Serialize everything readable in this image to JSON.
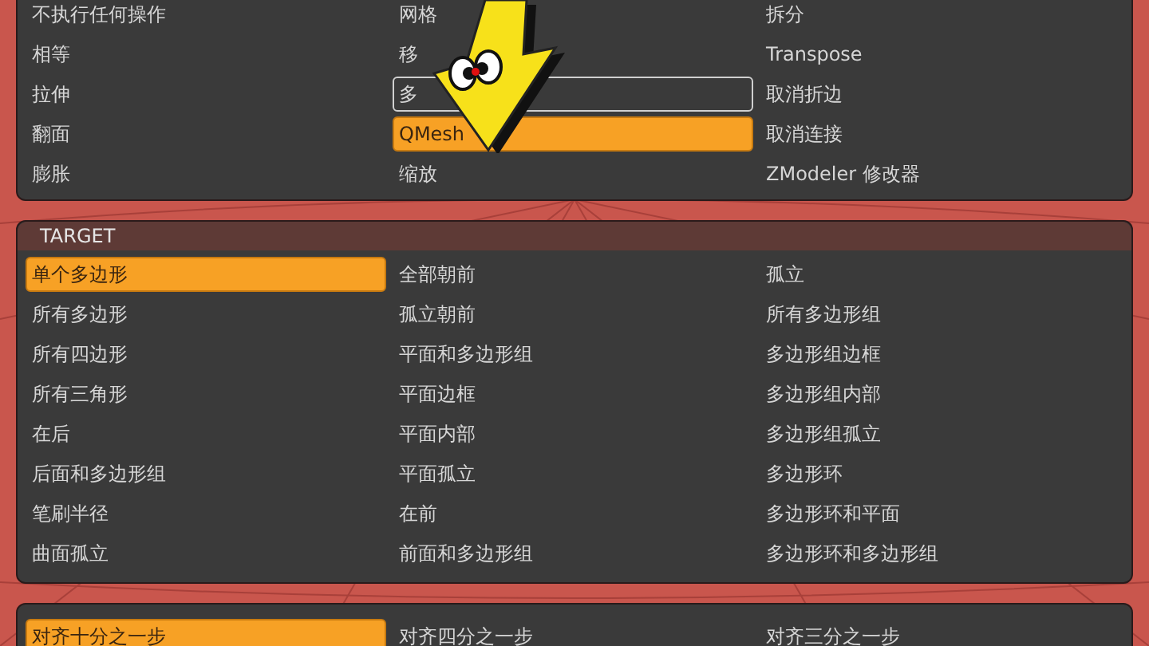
{
  "panels": [
    {
      "rows": [
        [
          {
            "label": "不执行任何操作",
            "selected": false,
            "outlined": false
          },
          {
            "label": "网格",
            "selected": false,
            "outlined": false
          },
          {
            "label": "拆分",
            "selected": false,
            "outlined": false
          }
        ],
        [
          {
            "label": "相等",
            "selected": false,
            "outlined": false
          },
          {
            "label": "移",
            "selected": false,
            "outlined": false
          },
          {
            "label": "Transpose",
            "selected": false,
            "outlined": false
          }
        ],
        [
          {
            "label": "拉伸",
            "selected": false,
            "outlined": false
          },
          {
            "label": "多",
            "selected": false,
            "outlined": true
          },
          {
            "label": "取消折边",
            "selected": false,
            "outlined": false
          }
        ],
        [
          {
            "label": "翻面",
            "selected": false,
            "outlined": false
          },
          {
            "label": "QMesh",
            "selected": true,
            "outlined": false
          },
          {
            "label": "取消连接",
            "selected": false,
            "outlined": false
          }
        ],
        [
          {
            "label": "膨胀",
            "selected": false,
            "outlined": false
          },
          {
            "label": "缩放",
            "selected": false,
            "outlined": false
          },
          {
            "label": "ZModeler 修改器",
            "selected": false,
            "outlined": false
          }
        ]
      ]
    },
    {
      "header": "TARGET",
      "rows": [
        [
          {
            "label": "单个多边形",
            "selected": true,
            "outlined": false
          },
          {
            "label": "全部朝前",
            "selected": false,
            "outlined": false
          },
          {
            "label": "孤立",
            "selected": false,
            "outlined": false
          }
        ],
        [
          {
            "label": "所有多边形",
            "selected": false,
            "outlined": false
          },
          {
            "label": "孤立朝前",
            "selected": false,
            "outlined": false
          },
          {
            "label": "所有多边形组",
            "selected": false,
            "outlined": false
          }
        ],
        [
          {
            "label": "所有四边形",
            "selected": false,
            "outlined": false
          },
          {
            "label": "平面和多边形组",
            "selected": false,
            "outlined": false
          },
          {
            "label": "多边形组边框",
            "selected": false,
            "outlined": false
          }
        ],
        [
          {
            "label": "所有三角形",
            "selected": false,
            "outlined": false
          },
          {
            "label": "平面边框",
            "selected": false,
            "outlined": false
          },
          {
            "label": "多边形组内部",
            "selected": false,
            "outlined": false
          }
        ],
        [
          {
            "label": "在后",
            "selected": false,
            "outlined": false
          },
          {
            "label": "平面内部",
            "selected": false,
            "outlined": false
          },
          {
            "label": "多边形组孤立",
            "selected": false,
            "outlined": false
          }
        ],
        [
          {
            "label": "后面和多边形组",
            "selected": false,
            "outlined": false
          },
          {
            "label": "平面孤立",
            "selected": false,
            "outlined": false
          },
          {
            "label": "多边形环",
            "selected": false,
            "outlined": false
          }
        ],
        [
          {
            "label": "笔刷半径",
            "selected": false,
            "outlined": false
          },
          {
            "label": "在前",
            "selected": false,
            "outlined": false
          },
          {
            "label": "多边形环和平面",
            "selected": false,
            "outlined": false
          }
        ],
        [
          {
            "label": "曲面孤立",
            "selected": false,
            "outlined": false
          },
          {
            "label": "前面和多边形组",
            "selected": false,
            "outlined": false
          },
          {
            "label": "多边形环和多边形组",
            "selected": false,
            "outlined": false
          }
        ]
      ]
    },
    {
      "rows": [
        [
          {
            "label": "对齐十分之一步",
            "selected": true,
            "outlined": false
          },
          {
            "label": "对齐四分之一步",
            "selected": false,
            "outlined": false
          },
          {
            "label": "对齐三分之一步",
            "selected": false,
            "outlined": false
          }
        ]
      ]
    }
  ]
}
